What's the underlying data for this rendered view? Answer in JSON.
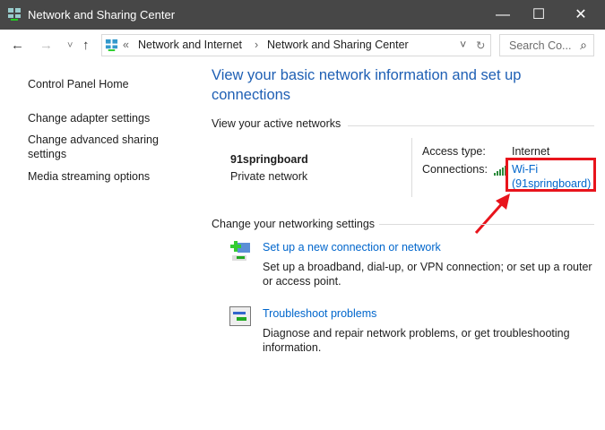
{
  "window": {
    "title": "Network and Sharing Center",
    "minimize": "—",
    "maximize": "☐",
    "close": "✕"
  },
  "nav": {
    "back": "←",
    "forward": "→",
    "recent": "˅",
    "up": "↑",
    "breadcrumb_sep": "«",
    "crumbs": [
      "Network and Internet",
      "Network and Sharing Center"
    ],
    "arrow": "›",
    "dropdown": "˅",
    "refresh": "↻",
    "search_placeholder": "Search Co...",
    "search_icon": "⌕"
  },
  "sidebar": {
    "items": [
      "Control Panel Home",
      "Change adapter settings",
      "Change advanced sharing settings",
      "Media streaming options"
    ]
  },
  "main": {
    "title": "View your basic network information and set up connections",
    "active_label": "View your active networks",
    "network_name": "91springboard",
    "network_type": "Private network",
    "access_type_label": "Access type:",
    "access_type": "Internet",
    "connections_label": "Connections:",
    "conn_line1": "Wi-Fi",
    "conn_line2": "(91springboard)",
    "change_label": "Change your networking settings",
    "tasks": [
      {
        "link": "Set up a new connection or network",
        "desc": "Set up a broadband, dial-up, or VPN connection; or set up a router or access point."
      },
      {
        "link": "Troubleshoot problems",
        "desc": "Diagnose and repair network problems, or get troubleshooting information."
      }
    ]
  },
  "colors": {
    "link": "#0066cc",
    "annotation": "#e8141c"
  }
}
